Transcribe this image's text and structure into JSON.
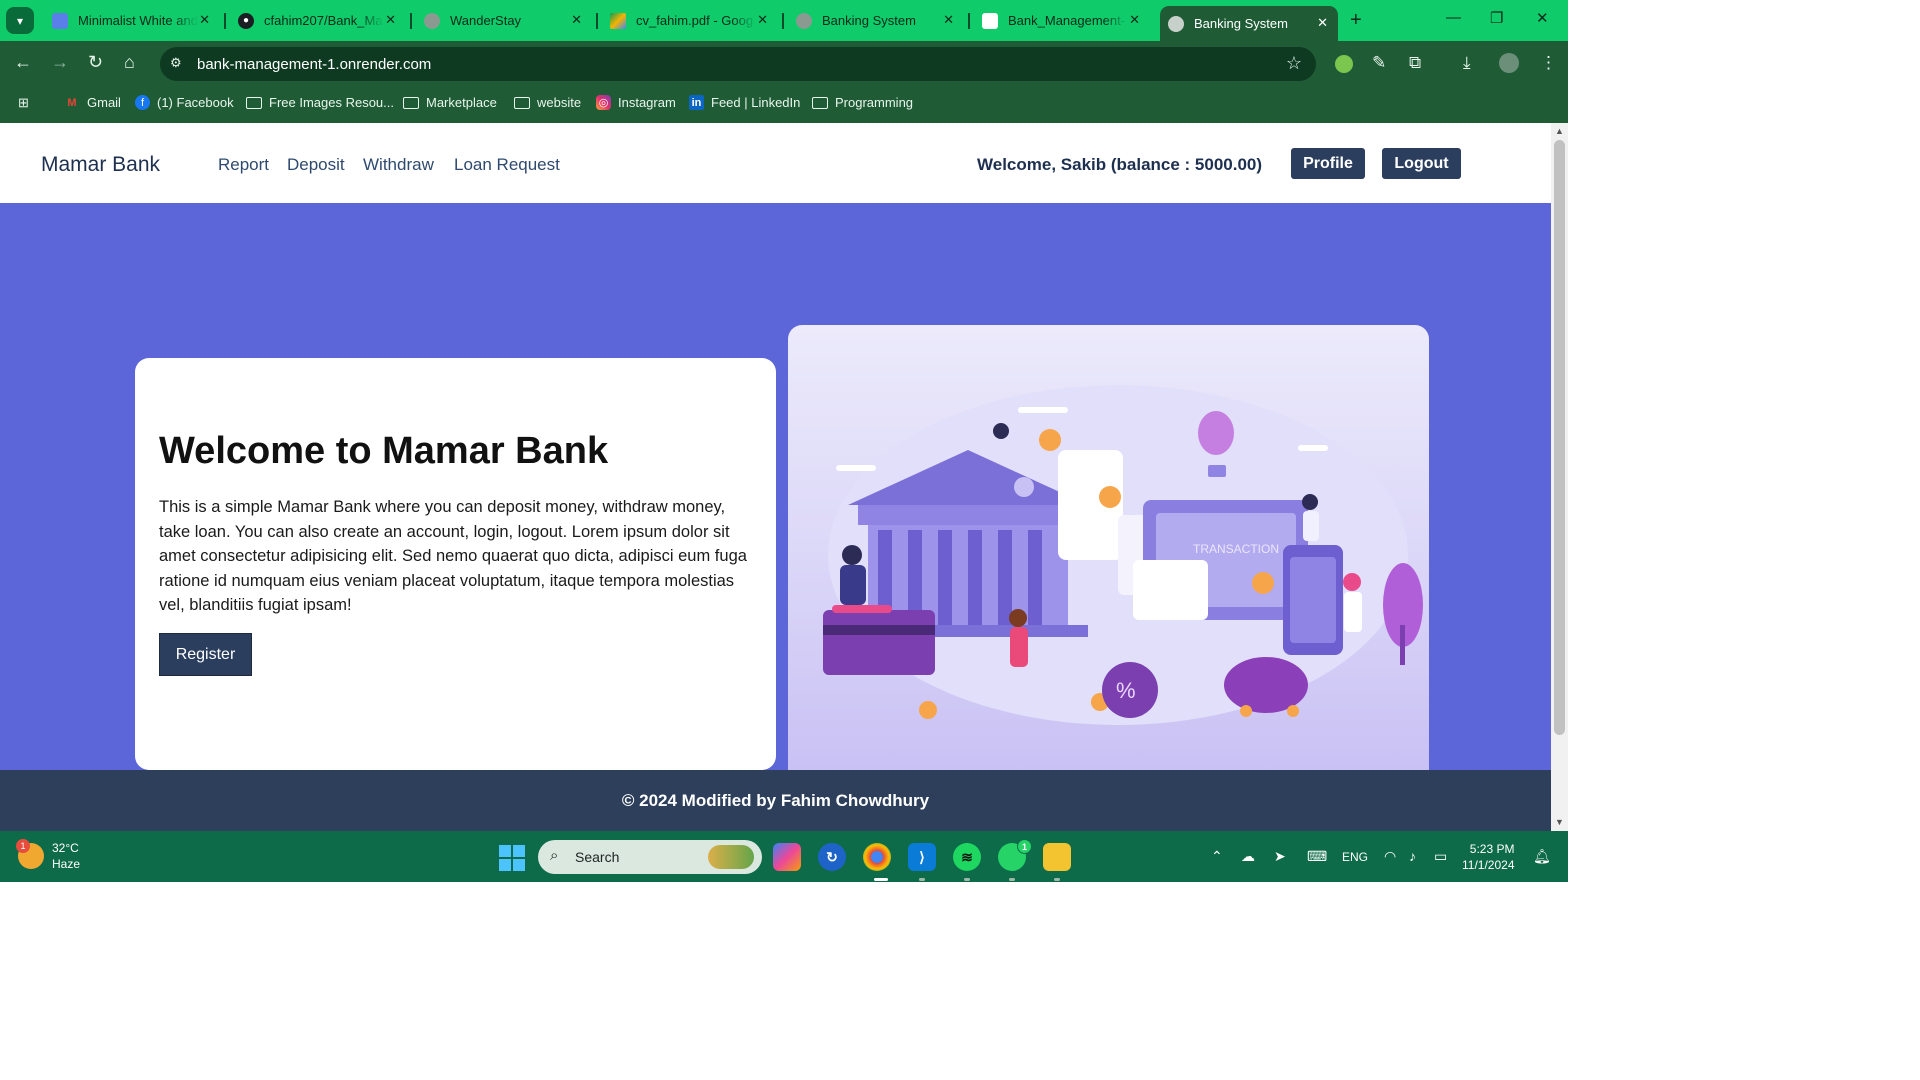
{
  "browser": {
    "tabs": [
      {
        "label": "Minimalist White and",
        "icon": "doc-icon",
        "color": "#5b7fe8"
      },
      {
        "label": "cfahim207/Bank_Ma",
        "icon": "github-icon",
        "color": "#1b1f23"
      },
      {
        "label": "WanderStay",
        "icon": "globe-icon",
        "color": "#8a9a90"
      },
      {
        "label": "cv_fahim.pdf - Goog",
        "icon": "drive-icon",
        "color": "#f4b400"
      },
      {
        "label": "Banking System",
        "icon": "globe-icon",
        "color": "#8a9a90"
      },
      {
        "label": "Bank_Management-",
        "icon": "render-icon",
        "color": "#ffffff"
      },
      {
        "label": "Banking System",
        "icon": "globe-icon",
        "color": "#c8d0cb",
        "active": true
      }
    ],
    "url": "bank-management-1.onrender.com",
    "bookmarks": [
      {
        "label": "Gmail",
        "icon": "gmail-icon"
      },
      {
        "label": "(1) Facebook",
        "icon": "facebook-icon"
      },
      {
        "label": "Free Images Resou...",
        "icon": "folder-icon"
      },
      {
        "label": "Marketplace",
        "icon": "folder-icon"
      },
      {
        "label": "website",
        "icon": "folder-icon"
      },
      {
        "label": "Instagram",
        "icon": "instagram-icon"
      },
      {
        "label": "Feed | LinkedIn",
        "icon": "linkedin-icon"
      },
      {
        "label": "Programming",
        "icon": "folder-icon"
      }
    ]
  },
  "site": {
    "brand": "Mamar Bank",
    "nav": [
      "Report",
      "Deposit",
      "Withdraw",
      "Loan Request"
    ],
    "welcome": "Welcome, Sakib (balance : 5000.00)",
    "profile_label": "Profile",
    "logout_label": "Logout",
    "hero": {
      "title": "Welcome to Mamar Bank",
      "body": "This is a simple Mamar Bank where you can deposit money, withdraw money, take loan. You can also create an account, login, logout. Lorem ipsum dolor sit amet consectetur adipisicing elit. Sed nemo quaerat quo dicta, adipisci eum fuga ratione id numquam eius veniam placeat voluptatum, itaque tempora molestias vel, blanditiis fugiat ipsam!",
      "register_label": "Register",
      "illustration_text": "TRANSACTION"
    },
    "footer": "© 2024 Modified by Fahim Chowdhury",
    "colors": {
      "hero_bg": "#5d66d8",
      "button": "#2c3e5e",
      "footer": "#2d3f5a"
    }
  },
  "taskbar": {
    "weather_temp": "32°C",
    "weather_desc": "Haze",
    "weather_badge": "1",
    "search_label": "Search",
    "whatsapp_badge": "1",
    "lang": "ENG",
    "time": "5:23 PM",
    "date": "11/1/2024"
  }
}
